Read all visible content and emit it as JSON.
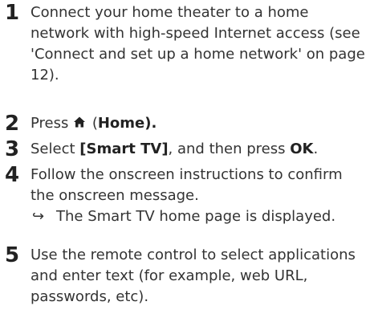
{
  "steps": [
    {
      "number": "1",
      "text": "Connect your home theater to a home network with high-speed Internet access (see 'Connect and set up a home network' on page 12)."
    },
    {
      "number": "2",
      "prefix": "Press ",
      "icon": "home-icon",
      "paren_open": " (",
      "bold": "Home",
      "suffix": ")."
    },
    {
      "number": "3",
      "prefix": "Select ",
      "bold1": "[Smart TV]",
      "middle": ", and then press ",
      "bold2": "OK",
      "suffix": "."
    },
    {
      "number": "4",
      "text": "Follow the onscreen instructions to confirm the onscreen message.",
      "result_arrow": "↪",
      "result": "The Smart TV home page is displayed."
    },
    {
      "number": "5",
      "text": "Use the remote control to select applications and enter text (for example, web URL, passwords, etc)."
    }
  ]
}
